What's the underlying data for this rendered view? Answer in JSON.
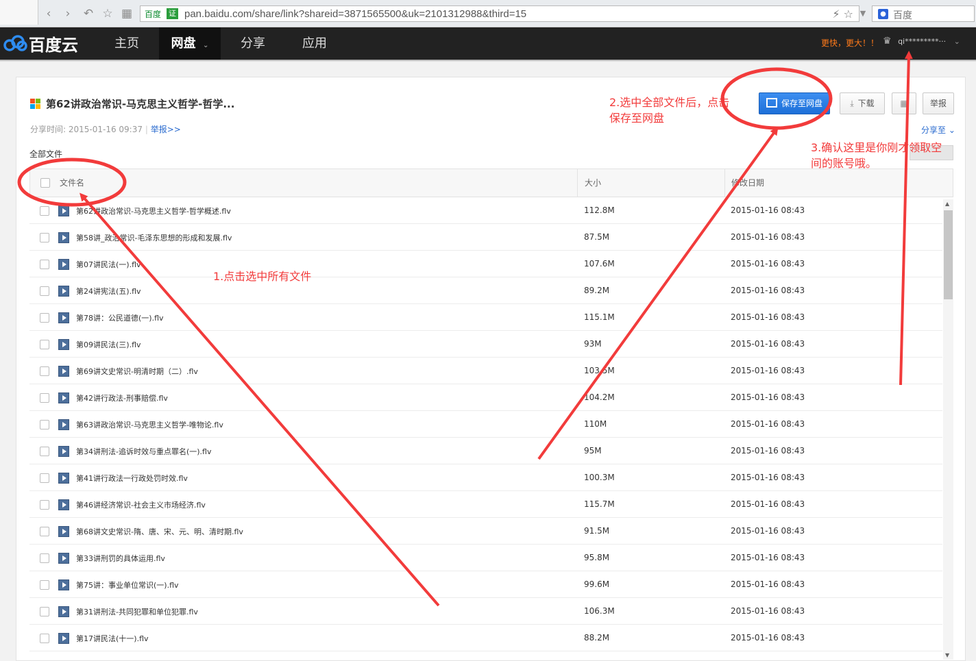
{
  "browser": {
    "site_label": "百度",
    "cert_label": "证",
    "url": "pan.baidu.com/share/link?shareid=3871565500&uk=2101312988&third=15",
    "search_engine": "百度"
  },
  "nav": {
    "logo_text": "百度云",
    "items": [
      "主页",
      "网盘",
      "分享",
      "应用"
    ],
    "promo": "更快，更大！！",
    "user": "qi*********···"
  },
  "share": {
    "title": "第62讲政治常识-马克思主义哲学-哲学...",
    "meta_label": "分享时间: 2015-01-16 09:37",
    "report_link": "举报>>",
    "all_files": "全部文件",
    "share_to": "分享至"
  },
  "buttons": {
    "save": "保存至网盘",
    "download": "下载",
    "report": "举报"
  },
  "table": {
    "col_name": "文件名",
    "col_size": "大小",
    "col_date": "修改日期",
    "rows": [
      {
        "name": "第62讲政治常识-马克思主义哲学-哲学概述.flv",
        "size": "112.8M",
        "date": "2015-01-16 08:43"
      },
      {
        "name": "第58讲_政治常识-毛泽东思想的形成和发展.flv",
        "size": "87.5M",
        "date": "2015-01-16 08:43"
      },
      {
        "name": "第07讲民法(一).flv",
        "size": "107.6M",
        "date": "2015-01-16 08:43"
      },
      {
        "name": "第24讲宪法(五).flv",
        "size": "89.2M",
        "date": "2015-01-16 08:43"
      },
      {
        "name": "第78讲：公民道德(一).flv",
        "size": "115.1M",
        "date": "2015-01-16 08:43"
      },
      {
        "name": "第09讲民法(三).flv",
        "size": "93M",
        "date": "2015-01-16 08:43"
      },
      {
        "name": "第69讲文史常识-明清时期（二）.flv",
        "size": "103.5M",
        "date": "2015-01-16 08:43"
      },
      {
        "name": "第42讲行政法-刑事赔偿.flv",
        "size": "104.2M",
        "date": "2015-01-16 08:43"
      },
      {
        "name": "第63讲政治常识-马克思主义哲学-唯物论.flv",
        "size": "110M",
        "date": "2015-01-16 08:43"
      },
      {
        "name": "第34讲刑法-追诉时效与重点罪名(一).flv",
        "size": "95M",
        "date": "2015-01-16 08:43"
      },
      {
        "name": "第41讲行政法一行政处罚时效.flv",
        "size": "100.3M",
        "date": "2015-01-16 08:43"
      },
      {
        "name": "第46讲经济常识-社会主义市场经济.flv",
        "size": "115.7M",
        "date": "2015-01-16 08:43"
      },
      {
        "name": "第68讲文史常识-隋、唐、宋、元、明、清时期.flv",
        "size": "91.5M",
        "date": "2015-01-16 08:43"
      },
      {
        "name": "第33讲刑罚的具体运用.flv",
        "size": "95.8M",
        "date": "2015-01-16 08:43"
      },
      {
        "name": "第75讲：事业单位常识(一).flv",
        "size": "99.6M",
        "date": "2015-01-16 08:43"
      },
      {
        "name": "第31讲刑法-共同犯罪和单位犯罪.flv",
        "size": "106.3M",
        "date": "2015-01-16 08:43"
      },
      {
        "name": "第17讲民法(十一).flv",
        "size": "88.2M",
        "date": "2015-01-16 08:43"
      }
    ]
  },
  "annotations": {
    "step1": "1.点击选中所有文件",
    "step2_line1": "2.选中全部文件后，点击",
    "step2_line2": "保存至网盘",
    "step3_line1": "3.确认这里是你刚才领取空",
    "step3_line2": "间的账号哦。"
  },
  "colors": {
    "nav_bg": "#222222",
    "save_button": "#1d6fd8",
    "annotation": "#f23b3b",
    "link": "#2a6bcf",
    "promo": "#ff7a1a"
  }
}
